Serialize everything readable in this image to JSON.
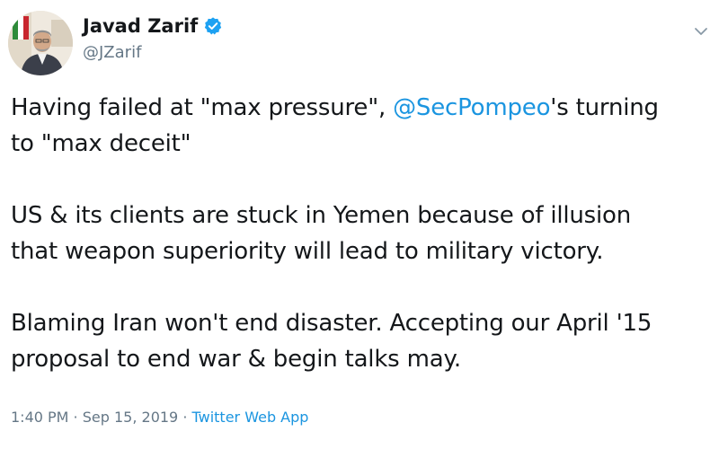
{
  "author": {
    "name": "Javad Zarif",
    "handle": "@JZarif",
    "verified_icon": "verified-badge-icon",
    "avatar_icon": "profile-photo-avatar"
  },
  "menu": {
    "icon": "chevron-down-icon"
  },
  "tweet": {
    "paragraph1": {
      "before": "Having failed at \"max pressure\", ",
      "mention": "@SecPompeo",
      "after": "'s turning",
      "line2": "to \"max deceit\""
    },
    "paragraph2": {
      "line1": "US & its clients are stuck in Yemen because of illusion",
      "line2": "that weapon superiority will lead to military victory."
    },
    "paragraph3": {
      "line1": "Blaming Iran won't end disaster. Accepting our April '15",
      "line2": "proposal to end war & begin talks may."
    }
  },
  "meta": {
    "time": "1:40 PM",
    "separator1": " · ",
    "date": "Sep 15, 2019",
    "separator2": " · ",
    "source": "Twitter Web App"
  },
  "colors": {
    "link": "#1b95e0",
    "text": "#14171a",
    "secondary": "#657786",
    "verified": "#1da1f2"
  }
}
